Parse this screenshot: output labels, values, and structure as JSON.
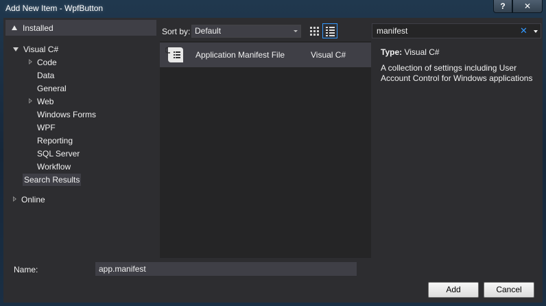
{
  "window": {
    "title": "Add New Item - WpfButton",
    "help_label": "?",
    "close_label": "✕"
  },
  "tree": {
    "installed_label": "Installed",
    "visual_csharp_label": "Visual C#",
    "items": [
      {
        "label": "Code"
      },
      {
        "label": "Data"
      },
      {
        "label": "General"
      },
      {
        "label": "Web"
      },
      {
        "label": "Windows Forms"
      },
      {
        "label": "WPF"
      },
      {
        "label": "Reporting"
      },
      {
        "label": "SQL Server"
      },
      {
        "label": "Workflow"
      }
    ],
    "search_results_label": "Search Results",
    "online_label": "Online"
  },
  "sort": {
    "label": "Sort by:",
    "value": "Default"
  },
  "templates": [
    {
      "name": "Application Manifest File",
      "language": "Visual C#"
    }
  ],
  "search": {
    "value": "manifest",
    "clear_label": "✕"
  },
  "details": {
    "type_label": "Type:",
    "type_value": "Visual C#",
    "description": "A collection of settings including User Account Control for Windows applications"
  },
  "bottom": {
    "name_label": "Name:",
    "name_value": "app.manifest",
    "add_label": "Add",
    "cancel_label": "Cancel"
  }
}
